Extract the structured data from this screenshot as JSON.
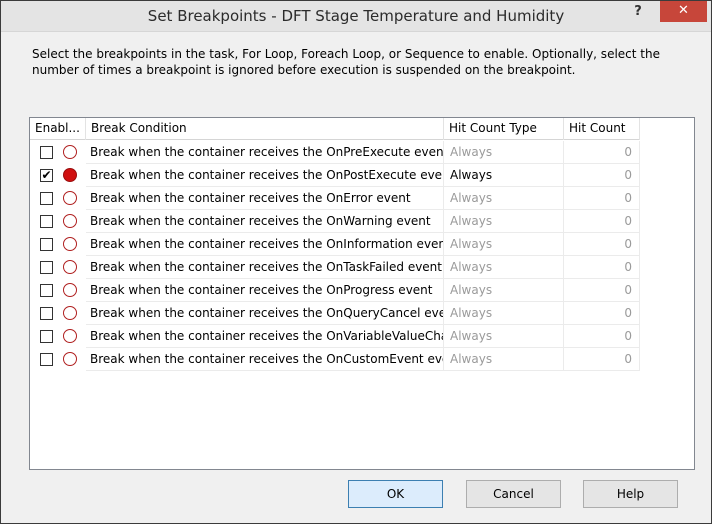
{
  "window": {
    "title": "Set Breakpoints - DFT Stage Temperature and Humidity",
    "help_glyph": "?",
    "close_glyph": "✕"
  },
  "description": "Select the breakpoints in the task, For Loop, Foreach Loop, or Sequence to enable. Optionally, select the number of times a breakpoint is ignored before execution is suspended on the breakpoint.",
  "grid": {
    "columns": [
      "Enabl...",
      "Break Condition",
      "Hit Count Type",
      "Hit Count"
    ],
    "rows": [
      {
        "enabled": false,
        "condition": "Break when the container receives the OnPreExecute event",
        "hit_count_type": "Always",
        "hit_count": "0"
      },
      {
        "enabled": true,
        "condition": "Break when the container receives the OnPostExecute event",
        "hit_count_type": "Always",
        "hit_count": "0"
      },
      {
        "enabled": false,
        "condition": "Break when the container receives the OnError event",
        "hit_count_type": "Always",
        "hit_count": "0"
      },
      {
        "enabled": false,
        "condition": "Break when the container receives the OnWarning event",
        "hit_count_type": "Always",
        "hit_count": "0"
      },
      {
        "enabled": false,
        "condition": "Break when the container receives the OnInformation event",
        "hit_count_type": "Always",
        "hit_count": "0"
      },
      {
        "enabled": false,
        "condition": "Break when the container receives the OnTaskFailed event",
        "hit_count_type": "Always",
        "hit_count": "0"
      },
      {
        "enabled": false,
        "condition": "Break when the container receives the OnProgress event",
        "hit_count_type": "Always",
        "hit_count": "0"
      },
      {
        "enabled": false,
        "condition": "Break when the container receives the OnQueryCancel event",
        "hit_count_type": "Always",
        "hit_count": "0"
      },
      {
        "enabled": false,
        "condition": "Break when the container receives the OnVariableValueChanged...",
        "hit_count_type": "Always",
        "hit_count": "0"
      },
      {
        "enabled": false,
        "condition": "Break when the container receives the OnCustomEvent event",
        "hit_count_type": "Always",
        "hit_count": "0"
      }
    ]
  },
  "buttons": {
    "ok": "OK",
    "cancel": "Cancel",
    "help": "Help"
  },
  "icons": {
    "check_glyph": "✔",
    "breakpoint_icon": "breakpoint-icon",
    "breakpoint_color": "#d01010"
  }
}
